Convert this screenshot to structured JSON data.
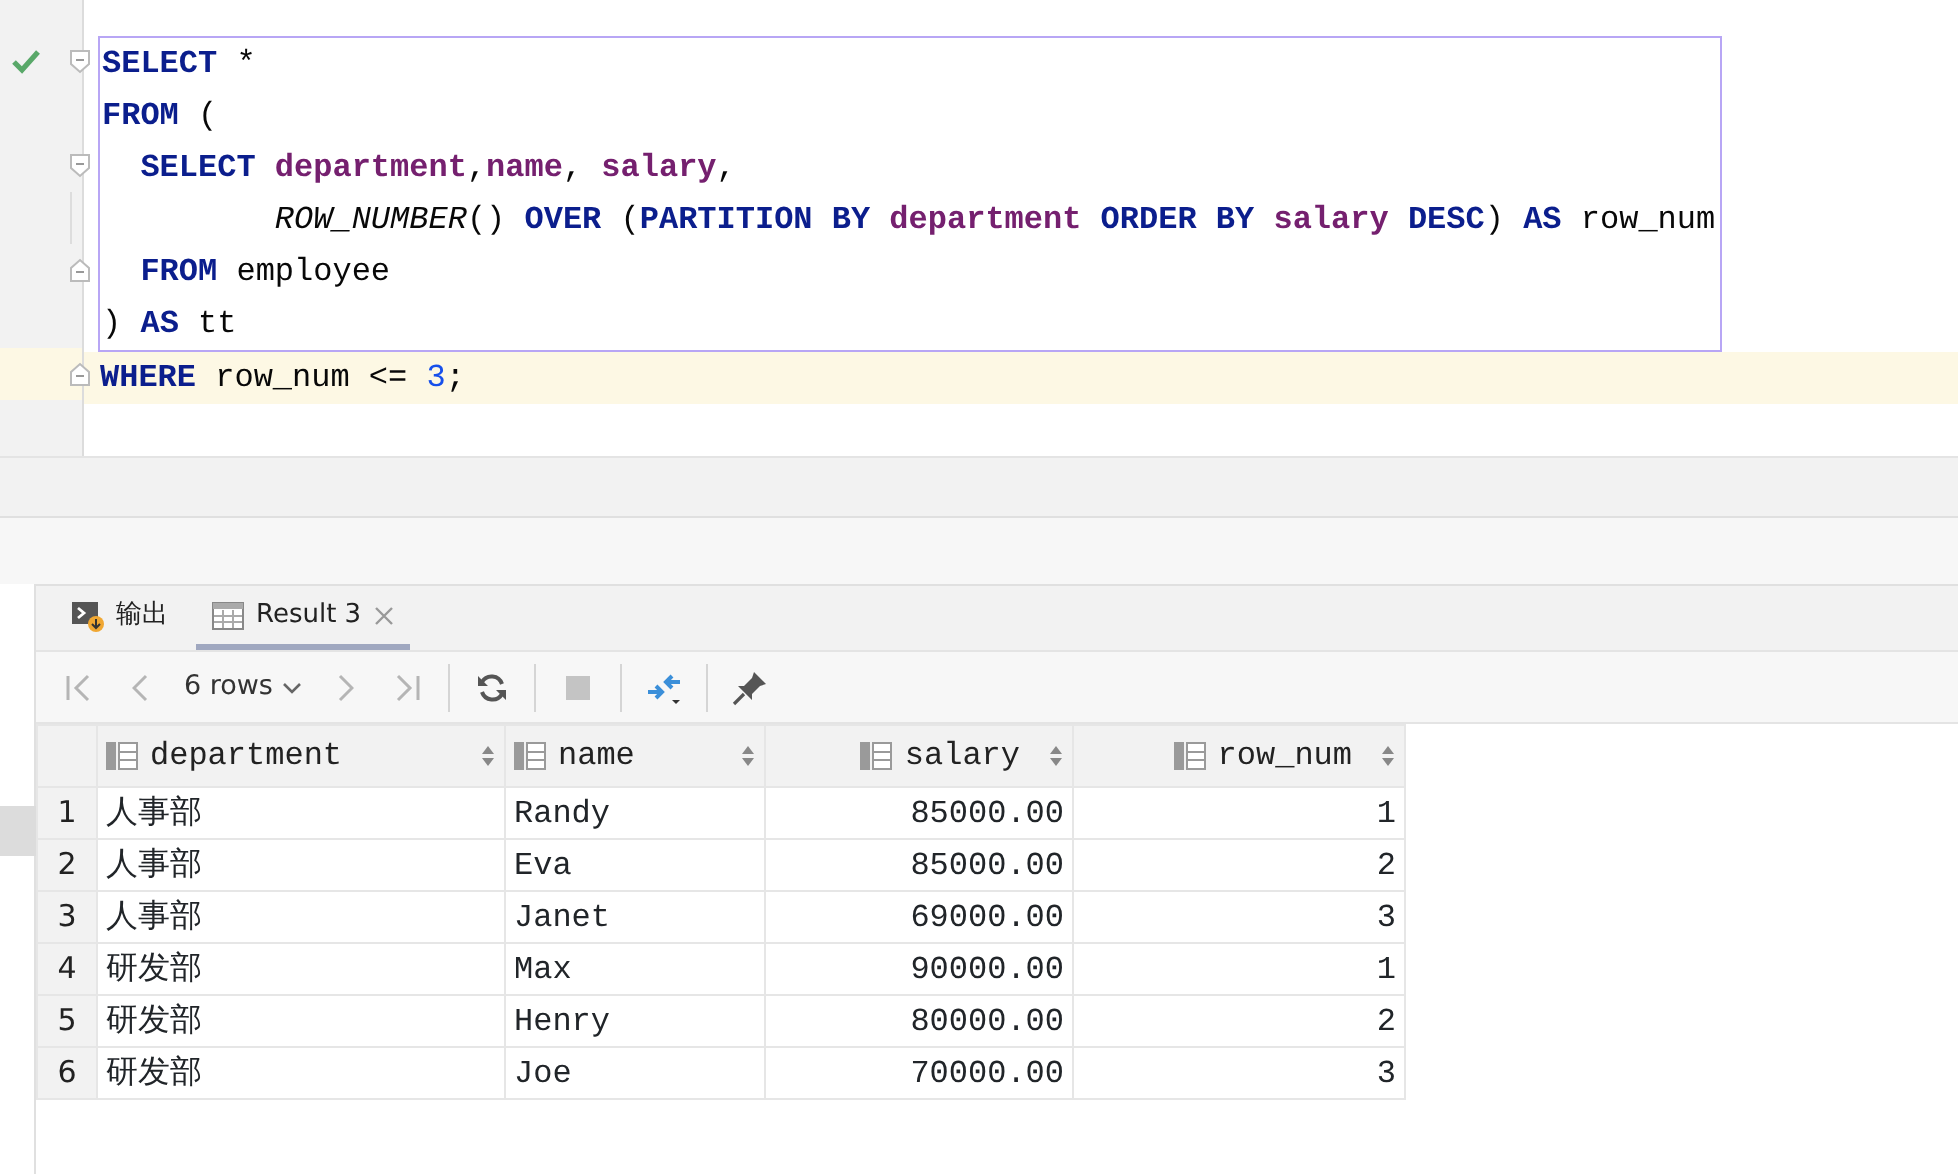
{
  "editor": {
    "lines": [
      {
        "kind": "fold-start",
        "current": false,
        "tokens": [
          {
            "kind": "kw",
            "text": "SELECT"
          },
          {
            "kind": "plain",
            "text": " *"
          }
        ]
      },
      {
        "kind": "plain",
        "current": false,
        "tokens": [
          {
            "kind": "kw",
            "text": "FROM"
          },
          {
            "kind": "plain",
            "text": " ("
          }
        ]
      },
      {
        "kind": "fold-start",
        "current": false,
        "tokens": [
          {
            "kind": "kw",
            "text": "  SELECT"
          },
          {
            "kind": "ident",
            "text": " department"
          },
          {
            "kind": "plain",
            "text": ","
          },
          {
            "kind": "ident",
            "text": "name"
          },
          {
            "kind": "plain",
            "text": ","
          },
          {
            "kind": "ident",
            "text": " salary"
          },
          {
            "kind": "plain",
            "text": ","
          }
        ]
      },
      {
        "kind": "guide",
        "current": false,
        "tokens": [
          {
            "kind": "fn",
            "text": "         ROW_NUMBER"
          },
          {
            "kind": "plain",
            "text": "()"
          },
          {
            "kind": "kw",
            "text": " OVER"
          },
          {
            "kind": "plain",
            "text": " ("
          },
          {
            "kind": "kw",
            "text": "PARTITION BY"
          },
          {
            "kind": "ident",
            "text": " department"
          },
          {
            "kind": "kw",
            "text": " ORDER BY"
          },
          {
            "kind": "ident",
            "text": " salary"
          },
          {
            "kind": "kw",
            "text": " DESC"
          },
          {
            "kind": "plain",
            "text": ")"
          },
          {
            "kind": "kw",
            "text": " AS"
          },
          {
            "kind": "plain",
            "text": " row_num"
          }
        ]
      },
      {
        "kind": "fold-end",
        "current": false,
        "tokens": [
          {
            "kind": "kw",
            "text": "  FROM"
          },
          {
            "kind": "plain",
            "text": " employee"
          }
        ]
      },
      {
        "kind": "plain",
        "current": false,
        "tokens": [
          {
            "kind": "plain",
            "text": ")"
          },
          {
            "kind": "kw",
            "text": " AS"
          },
          {
            "kind": "plain",
            "text": " tt"
          }
        ]
      },
      {
        "kind": "fold-end",
        "current": true,
        "tokens": [
          {
            "kind": "kw",
            "text": "WHERE"
          },
          {
            "kind": "plain",
            "text": " row_num <="
          },
          {
            "kind": "num",
            "text": " 3"
          },
          {
            "kind": "plain",
            "text": ";"
          }
        ]
      }
    ]
  },
  "tabs": [
    {
      "kind": "console",
      "label": "输出",
      "selected": false,
      "closable": false
    },
    {
      "kind": "table",
      "label": "Result 3",
      "selected": true,
      "closable": true
    }
  ],
  "toolbar": {
    "items": [
      {
        "kind": "first",
        "disabled": true
      },
      {
        "kind": "prev",
        "disabled": true
      },
      {
        "kind": "rows",
        "label": "6 rows"
      },
      {
        "kind": "next",
        "disabled": true
      },
      {
        "kind": "last",
        "disabled": true
      },
      {
        "kind": "sep"
      },
      {
        "kind": "refresh",
        "disabled": false
      },
      {
        "kind": "sep"
      },
      {
        "kind": "stop",
        "disabled": true
      },
      {
        "kind": "sep"
      },
      {
        "kind": "compare",
        "disabled": false
      },
      {
        "kind": "sep"
      },
      {
        "kind": "pin",
        "disabled": false
      }
    ]
  },
  "table": {
    "columns": [
      {
        "name": "department",
        "kind": "text"
      },
      {
        "name": "name",
        "kind": "text"
      },
      {
        "name": "salary",
        "kind": "number"
      },
      {
        "name": "row_num",
        "kind": "number"
      }
    ],
    "rows": [
      {
        "number": "1",
        "cells": [
          "人事部",
          "Randy",
          "85000.00",
          "1"
        ]
      },
      {
        "number": "2",
        "cells": [
          "人事部",
          "Eva",
          "85000.00",
          "2"
        ]
      },
      {
        "number": "3",
        "cells": [
          "人事部",
          "Janet",
          "69000.00",
          "3"
        ]
      },
      {
        "number": "4",
        "cells": [
          "研发部",
          "Max",
          "90000.00",
          "1"
        ]
      },
      {
        "number": "5",
        "cells": [
          "研发部",
          "Henry",
          "80000.00",
          "2"
        ]
      },
      {
        "number": "6",
        "cells": [
          "研发部",
          "Joe",
          "70000.00",
          "3"
        ]
      }
    ]
  }
}
